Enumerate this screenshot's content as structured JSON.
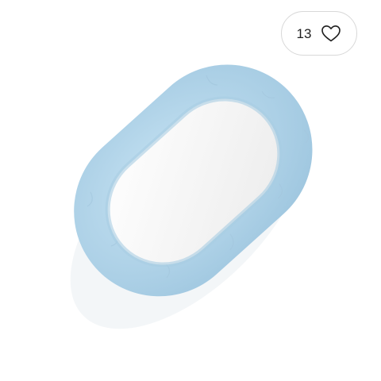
{
  "favorite": {
    "count": "13",
    "icon": "heart-outline-icon"
  },
  "product_image": {
    "subject": "baby nest",
    "colors": {
      "outer": "#b8d8ec",
      "inner": "#f6f6f6"
    }
  }
}
